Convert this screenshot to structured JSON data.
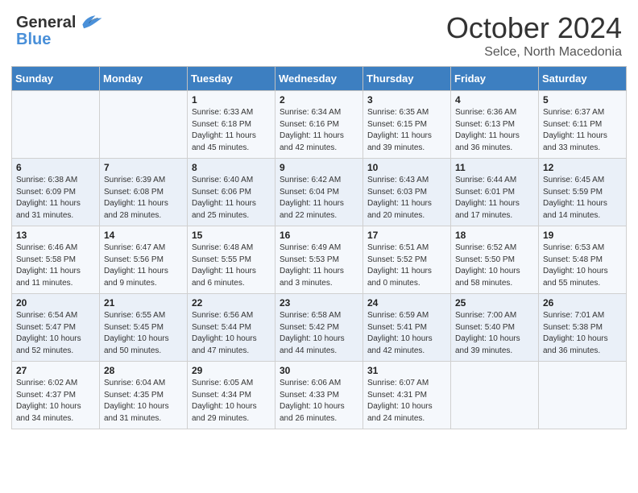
{
  "header": {
    "logo_text_general": "General",
    "logo_text_blue": "Blue",
    "month_title": "October 2024",
    "subtitle": "Selce, North Macedonia"
  },
  "days_of_week": [
    "Sunday",
    "Monday",
    "Tuesday",
    "Wednesday",
    "Thursday",
    "Friday",
    "Saturday"
  ],
  "weeks": [
    [
      {
        "day": "",
        "sunrise": "",
        "sunset": "",
        "daylight": ""
      },
      {
        "day": "",
        "sunrise": "",
        "sunset": "",
        "daylight": ""
      },
      {
        "day": "1",
        "sunrise": "Sunrise: 6:33 AM",
        "sunset": "Sunset: 6:18 PM",
        "daylight": "Daylight: 11 hours and 45 minutes."
      },
      {
        "day": "2",
        "sunrise": "Sunrise: 6:34 AM",
        "sunset": "Sunset: 6:16 PM",
        "daylight": "Daylight: 11 hours and 42 minutes."
      },
      {
        "day": "3",
        "sunrise": "Sunrise: 6:35 AM",
        "sunset": "Sunset: 6:15 PM",
        "daylight": "Daylight: 11 hours and 39 minutes."
      },
      {
        "day": "4",
        "sunrise": "Sunrise: 6:36 AM",
        "sunset": "Sunset: 6:13 PM",
        "daylight": "Daylight: 11 hours and 36 minutes."
      },
      {
        "day": "5",
        "sunrise": "Sunrise: 6:37 AM",
        "sunset": "Sunset: 6:11 PM",
        "daylight": "Daylight: 11 hours and 33 minutes."
      }
    ],
    [
      {
        "day": "6",
        "sunrise": "Sunrise: 6:38 AM",
        "sunset": "Sunset: 6:09 PM",
        "daylight": "Daylight: 11 hours and 31 minutes."
      },
      {
        "day": "7",
        "sunrise": "Sunrise: 6:39 AM",
        "sunset": "Sunset: 6:08 PM",
        "daylight": "Daylight: 11 hours and 28 minutes."
      },
      {
        "day": "8",
        "sunrise": "Sunrise: 6:40 AM",
        "sunset": "Sunset: 6:06 PM",
        "daylight": "Daylight: 11 hours and 25 minutes."
      },
      {
        "day": "9",
        "sunrise": "Sunrise: 6:42 AM",
        "sunset": "Sunset: 6:04 PM",
        "daylight": "Daylight: 11 hours and 22 minutes."
      },
      {
        "day": "10",
        "sunrise": "Sunrise: 6:43 AM",
        "sunset": "Sunset: 6:03 PM",
        "daylight": "Daylight: 11 hours and 20 minutes."
      },
      {
        "day": "11",
        "sunrise": "Sunrise: 6:44 AM",
        "sunset": "Sunset: 6:01 PM",
        "daylight": "Daylight: 11 hours and 17 minutes."
      },
      {
        "day": "12",
        "sunrise": "Sunrise: 6:45 AM",
        "sunset": "Sunset: 5:59 PM",
        "daylight": "Daylight: 11 hours and 14 minutes."
      }
    ],
    [
      {
        "day": "13",
        "sunrise": "Sunrise: 6:46 AM",
        "sunset": "Sunset: 5:58 PM",
        "daylight": "Daylight: 11 hours and 11 minutes."
      },
      {
        "day": "14",
        "sunrise": "Sunrise: 6:47 AM",
        "sunset": "Sunset: 5:56 PM",
        "daylight": "Daylight: 11 hours and 9 minutes."
      },
      {
        "day": "15",
        "sunrise": "Sunrise: 6:48 AM",
        "sunset": "Sunset: 5:55 PM",
        "daylight": "Daylight: 11 hours and 6 minutes."
      },
      {
        "day": "16",
        "sunrise": "Sunrise: 6:49 AM",
        "sunset": "Sunset: 5:53 PM",
        "daylight": "Daylight: 11 hours and 3 minutes."
      },
      {
        "day": "17",
        "sunrise": "Sunrise: 6:51 AM",
        "sunset": "Sunset: 5:52 PM",
        "daylight": "Daylight: 11 hours and 0 minutes."
      },
      {
        "day": "18",
        "sunrise": "Sunrise: 6:52 AM",
        "sunset": "Sunset: 5:50 PM",
        "daylight": "Daylight: 10 hours and 58 minutes."
      },
      {
        "day": "19",
        "sunrise": "Sunrise: 6:53 AM",
        "sunset": "Sunset: 5:48 PM",
        "daylight": "Daylight: 10 hours and 55 minutes."
      }
    ],
    [
      {
        "day": "20",
        "sunrise": "Sunrise: 6:54 AM",
        "sunset": "Sunset: 5:47 PM",
        "daylight": "Daylight: 10 hours and 52 minutes."
      },
      {
        "day": "21",
        "sunrise": "Sunrise: 6:55 AM",
        "sunset": "Sunset: 5:45 PM",
        "daylight": "Daylight: 10 hours and 50 minutes."
      },
      {
        "day": "22",
        "sunrise": "Sunrise: 6:56 AM",
        "sunset": "Sunset: 5:44 PM",
        "daylight": "Daylight: 10 hours and 47 minutes."
      },
      {
        "day": "23",
        "sunrise": "Sunrise: 6:58 AM",
        "sunset": "Sunset: 5:42 PM",
        "daylight": "Daylight: 10 hours and 44 minutes."
      },
      {
        "day": "24",
        "sunrise": "Sunrise: 6:59 AM",
        "sunset": "Sunset: 5:41 PM",
        "daylight": "Daylight: 10 hours and 42 minutes."
      },
      {
        "day": "25",
        "sunrise": "Sunrise: 7:00 AM",
        "sunset": "Sunset: 5:40 PM",
        "daylight": "Daylight: 10 hours and 39 minutes."
      },
      {
        "day": "26",
        "sunrise": "Sunrise: 7:01 AM",
        "sunset": "Sunset: 5:38 PM",
        "daylight": "Daylight: 10 hours and 36 minutes."
      }
    ],
    [
      {
        "day": "27",
        "sunrise": "Sunrise: 6:02 AM",
        "sunset": "Sunset: 4:37 PM",
        "daylight": "Daylight: 10 hours and 34 minutes."
      },
      {
        "day": "28",
        "sunrise": "Sunrise: 6:04 AM",
        "sunset": "Sunset: 4:35 PM",
        "daylight": "Daylight: 10 hours and 31 minutes."
      },
      {
        "day": "29",
        "sunrise": "Sunrise: 6:05 AM",
        "sunset": "Sunset: 4:34 PM",
        "daylight": "Daylight: 10 hours and 29 minutes."
      },
      {
        "day": "30",
        "sunrise": "Sunrise: 6:06 AM",
        "sunset": "Sunset: 4:33 PM",
        "daylight": "Daylight: 10 hours and 26 minutes."
      },
      {
        "day": "31",
        "sunrise": "Sunrise: 6:07 AM",
        "sunset": "Sunset: 4:31 PM",
        "daylight": "Daylight: 10 hours and 24 minutes."
      },
      {
        "day": "",
        "sunrise": "",
        "sunset": "",
        "daylight": ""
      },
      {
        "day": "",
        "sunrise": "",
        "sunset": "",
        "daylight": ""
      }
    ]
  ]
}
